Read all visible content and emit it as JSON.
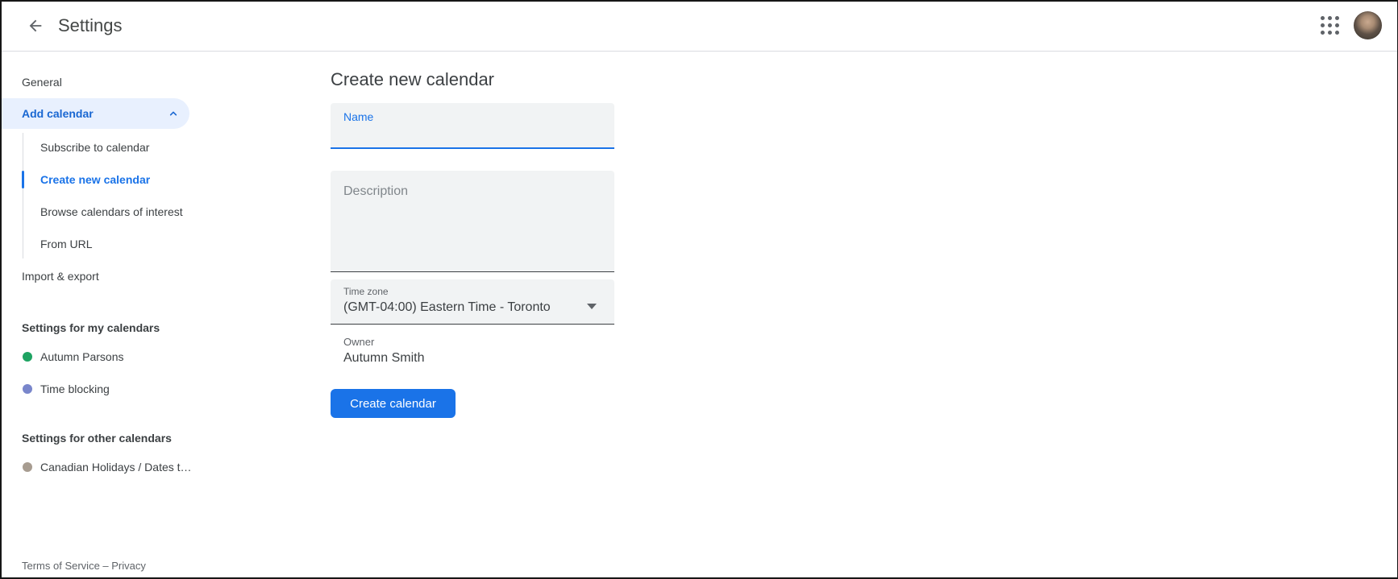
{
  "header": {
    "title": "Settings"
  },
  "sidebar": {
    "general_label": "General",
    "add_calendar_label": "Add calendar",
    "sub_items": [
      {
        "label": "Subscribe to calendar",
        "active": false
      },
      {
        "label": "Create new calendar",
        "active": true
      },
      {
        "label": "Browse calendars of interest",
        "active": false
      },
      {
        "label": "From URL",
        "active": false
      }
    ],
    "import_export_label": "Import & export",
    "my_calendars": {
      "heading": "Settings for my calendars",
      "items": [
        {
          "label": "Autumn Parsons",
          "color": "#1ea362"
        },
        {
          "label": "Time blocking",
          "color": "#7986cb"
        }
      ]
    },
    "other_calendars": {
      "heading": "Settings for other calendars",
      "items": [
        {
          "label": "Canadian Holidays / Dates t…",
          "color": "#a79c90"
        }
      ]
    },
    "footer_links": "Terms of Service – Privacy"
  },
  "main": {
    "title": "Create new calendar",
    "name_field": {
      "label": "Name",
      "value": ""
    },
    "description_field": {
      "placeholder": "Description",
      "value": ""
    },
    "timezone_field": {
      "label": "Time zone",
      "value": "(GMT-04:00) Eastern Time - Toronto"
    },
    "owner_field": {
      "label": "Owner",
      "value": "Autumn Smith"
    },
    "create_button_label": "Create calendar"
  },
  "colors": {
    "accent_blue": "#1a73e8",
    "sidebar_active_blue": "#1967d2",
    "pill_bg": "#e8f0fe",
    "field_bg": "#f1f3f4",
    "header_border": "#dadce0",
    "text_primary": "#3c4043",
    "text_secondary": "#5f6368"
  }
}
